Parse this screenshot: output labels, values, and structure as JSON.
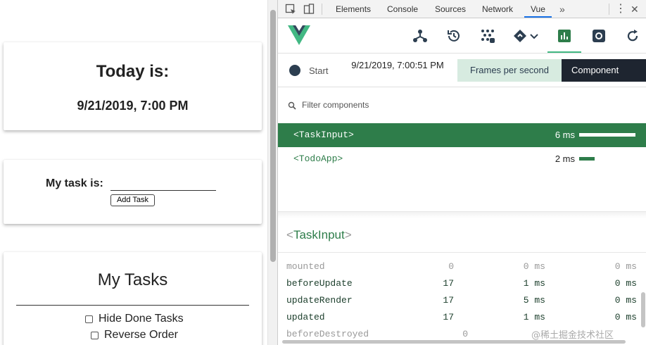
{
  "app": {
    "today_heading": "Today is:",
    "today_date": "9/21/2019, 7:00 PM",
    "task_label": "My task is:",
    "task_input_value": "",
    "add_task_label": "Add Task",
    "tasks_heading": "My Tasks",
    "hide_done_label": "Hide Done Tasks",
    "reverse_order_label": "Reverse Order"
  },
  "devtools": {
    "tabs": [
      "Elements",
      "Console",
      "Sources",
      "Network",
      "Vue"
    ],
    "active_tab": "Vue",
    "more": "»",
    "toolbar_icons": [
      "components-tree-icon",
      "history-icon",
      "vuex-icon",
      "events-icon",
      "performance-icon",
      "settings-icon",
      "refresh-icon"
    ],
    "perf": {
      "start_label": "Start",
      "timestamp": "9/21/2019, 7:00:51 PM",
      "fps_label": "Frames per second",
      "component_label": "Component"
    },
    "filter_placeholder": "Filter components",
    "components": [
      {
        "name": "<TaskInput>",
        "time": "6 ms",
        "fraction": 1.0
      },
      {
        "name": "<TodoApp>",
        "time": "2 ms",
        "fraction": 0.28
      }
    ],
    "detail": {
      "open_bracket": "<",
      "name": "TaskInput",
      "close_bracket": ">",
      "hooks": [
        {
          "name": "mounted",
          "count": "0",
          "total": "0 ms",
          "avg": "0 ms"
        },
        {
          "name": "beforeUpdate",
          "count": "17",
          "total": "1 ms",
          "avg": "0 ms"
        },
        {
          "name": "updateRender",
          "count": "17",
          "total": "5 ms",
          "avg": "0 ms"
        },
        {
          "name": "updated",
          "count": "17",
          "total": "1 ms",
          "avg": "0 ms"
        },
        {
          "name": "beforeDestroyed",
          "count": "0",
          "total": "",
          "avg": ""
        }
      ]
    },
    "watermark": "@稀土掘金技术社区"
  },
  "colors": {
    "vue_green": "#42b883",
    "row_green": "#2e7d4a",
    "dark": "#1e2530"
  }
}
